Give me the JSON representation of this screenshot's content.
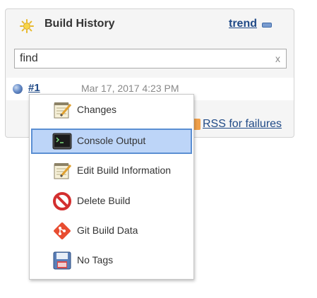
{
  "header": {
    "title": "Build History",
    "trend_label": "trend"
  },
  "search": {
    "value": "find",
    "clear_label": "x"
  },
  "build": {
    "number": "#1",
    "time": "Mar 17, 2017 4:23 PM",
    "status_color": "#4a70b5"
  },
  "rss": {
    "failures_label": "RSS for failures"
  },
  "menu": {
    "items": [
      {
        "label": "Changes",
        "icon": "notepad-icon"
      },
      {
        "label": "Console Output",
        "icon": "terminal-icon",
        "selected": true
      },
      {
        "label": "Edit Build Information",
        "icon": "notepad-icon"
      },
      {
        "label": "Delete Build",
        "icon": "no-entry-icon"
      },
      {
        "label": "Git Build Data",
        "icon": "git-icon"
      },
      {
        "label": "No Tags",
        "icon": "save-icon"
      }
    ]
  },
  "colors": {
    "link": "#204a87",
    "selected_bg": "#bdd5f8",
    "selected_border": "#5b8fd3"
  }
}
